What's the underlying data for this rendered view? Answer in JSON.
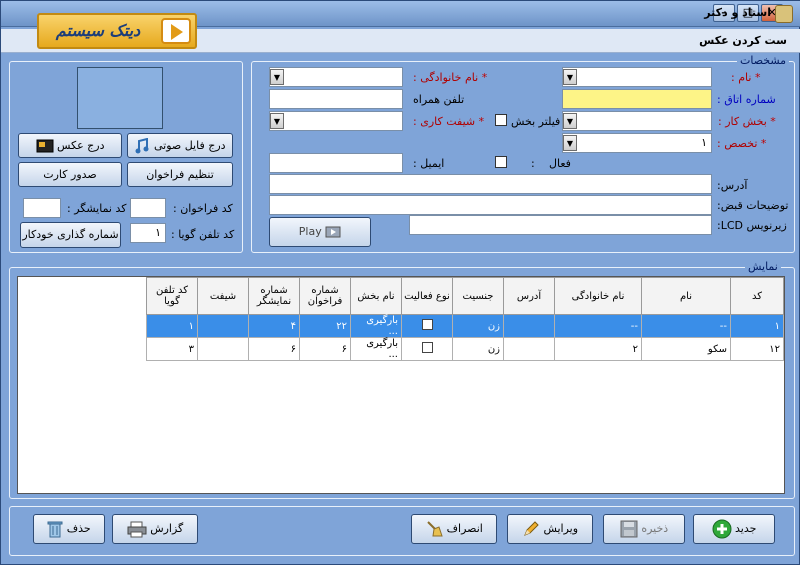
{
  "window": {
    "title": "استاد و دکتر"
  },
  "logo": {
    "text": "دیتک سیستم"
  },
  "subbar": {
    "title": "ست کردن عکس"
  },
  "details": {
    "group_label": "مشخصات",
    "name_label": "نام :",
    "family_label": "نام خانوادگی :",
    "room_label": "شماره اتاق :",
    "mobile_label": "تلفن همراه",
    "department_label": "بخش کار :",
    "filter_label": "فیلتر بخش",
    "shift_label": "شیفت کاری :",
    "specialty_label": "تخصص :",
    "specialty_value": "۱",
    "active_label": "فعال",
    "active_colon": ":",
    "email_label": "ایمیل :",
    "address_label": "آدرس:",
    "receipt_label": "توضیحات قبض:",
    "lcd_label": "زیرنویس LCD:",
    "play_label": "Play",
    "required_star": "*"
  },
  "photo_panel": {
    "insert_photo": "درج عکس",
    "insert_audio": "درج فایل صوتی",
    "issue_card": "صدور کارت",
    "set_call": "تنظیم فراخوان",
    "display_code_label": "کد نمایشگر :",
    "call_code_label": "کد فراخوان :",
    "talker_code_label": "کد تلفن گویا :",
    "talker_code_value": "۱",
    "auto_number": "شماره گذاری خودکار"
  },
  "display": {
    "group_label": "نمایش",
    "columns": [
      "کد",
      "نام",
      "نام خانوادگی",
      "آدرس",
      "جنسیت",
      "نوع فعالیت",
      "نام بخش",
      "شماره فراخوان",
      "شماره نمایشگر",
      "شیفت",
      "کد تلفن گویا"
    ],
    "rows": [
      {
        "code": "۱",
        "name": "--",
        "family": "--",
        "address": "",
        "gender": "زن",
        "active": false,
        "dept": "بارگیری ...",
        "call": "۲۲",
        "disp": "۴",
        "shift": "",
        "talker": "۱",
        "selected": true
      },
      {
        "code": "۱۲",
        "name": "سکو",
        "family": "۲",
        "address": "",
        "gender": "زن",
        "active": false,
        "dept": "بارگیری ...",
        "call": "۶",
        "disp": "۶",
        "shift": "",
        "talker": "۳",
        "selected": false
      }
    ]
  },
  "footer": {
    "new": "جدید",
    "save": "ذخیره",
    "edit": "ویرایش",
    "cancel": "انصراف",
    "report": "گزارش",
    "delete": "حذف"
  },
  "colors": {
    "window": "#7fa4d8",
    "selected_row": "#3a8ee8",
    "room_field": "#fdf487"
  }
}
